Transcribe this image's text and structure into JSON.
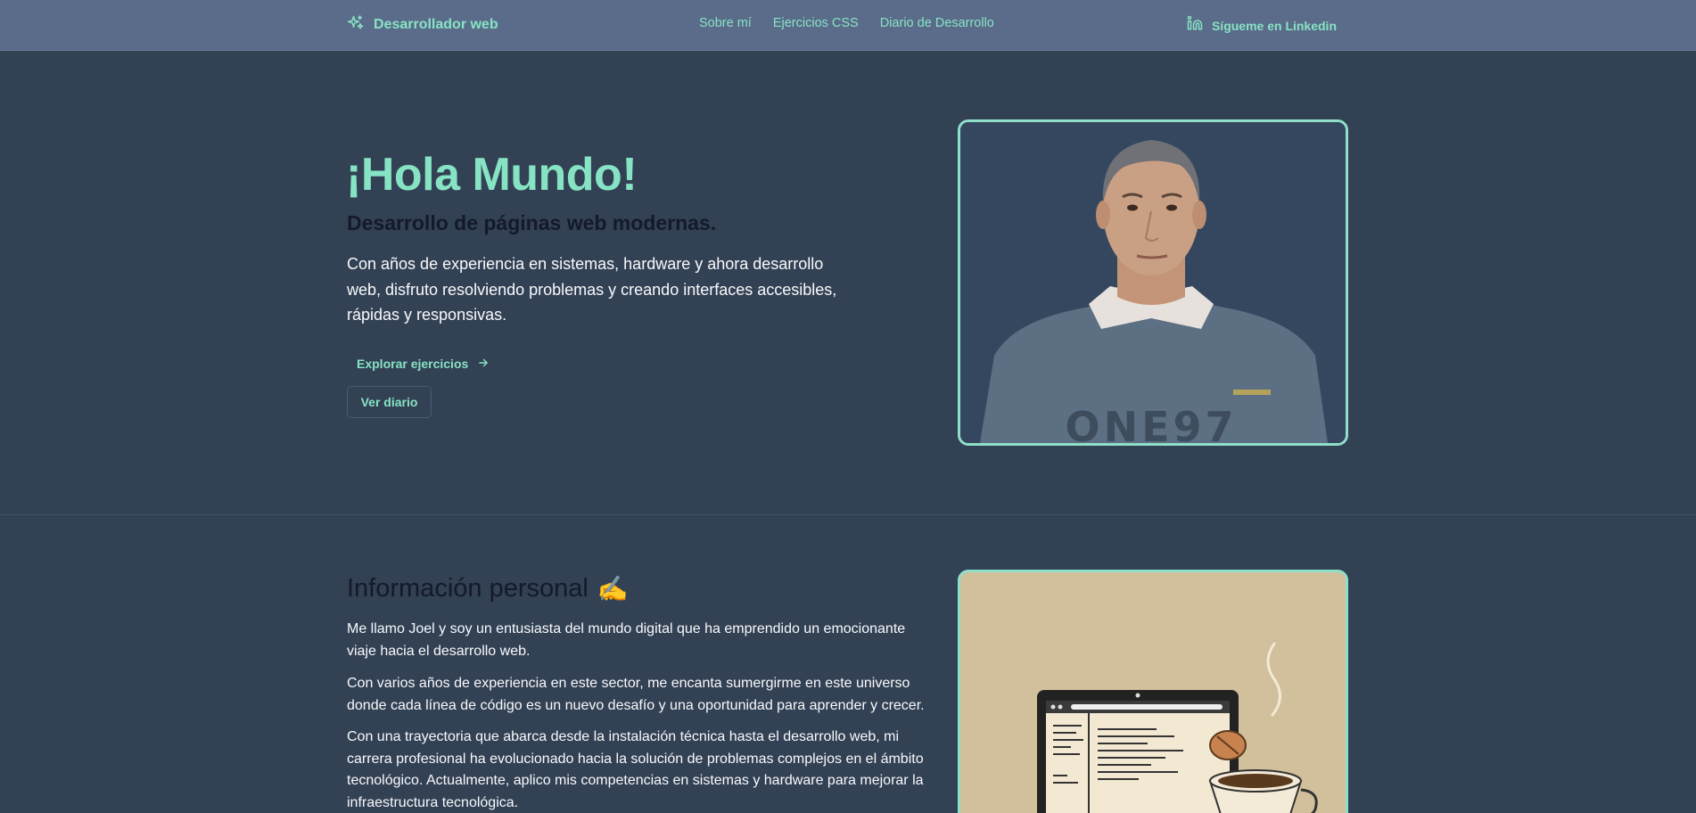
{
  "header": {
    "brand": "Desarrollador web",
    "nav": [
      "Sobre mí",
      "Ejercicios CSS",
      "Diario de Desarrollo"
    ],
    "linkedin": "Sígueme en Linkedin"
  },
  "hero": {
    "title": "¡Hola Mundo!",
    "subtitle": "Desarrollo de páginas web modernas.",
    "text": "Con años de experiencia en sistemas, hardware y ahora desarrollo web, disfruto resolviendo problemas y creando interfaces accesibles, rápidas y responsivas.",
    "explore_label": "Explorar ejercicios",
    "diary_label": "Ver diario",
    "photo_sweater_text": "ONE97"
  },
  "info": {
    "title": "Información personal",
    "emoji": "✍️",
    "paragraphs": [
      "Me llamo Joel y soy un entusiasta del mundo digital que ha emprendido un emocionante viaje hacia el desarrollo web.",
      "Con varios años de experiencia en este sector, me encanta sumergirme en este universo donde cada línea de código es un nuevo desafío y una oportunidad para aprender y crecer.",
      "Con una trayectoria que abarca desde la instalación técnica hasta el desarrollo web, mi carrera profesional ha evolucionado hacia la solución de problemas complejos en el ámbito tecnológico. Actualmente, aplico mis competencias en sistemas y hardware para mejorar la infraestructura tecnológica."
    ]
  },
  "colors": {
    "background": "#334155",
    "header": "#5b6b8a",
    "accent": "#86e3c3",
    "dark_text": "#131a2a"
  },
  "icons": {
    "brand": "sparkles-icon",
    "linkedin": "linkedin-icon",
    "explore": "arrow-right-icon"
  }
}
